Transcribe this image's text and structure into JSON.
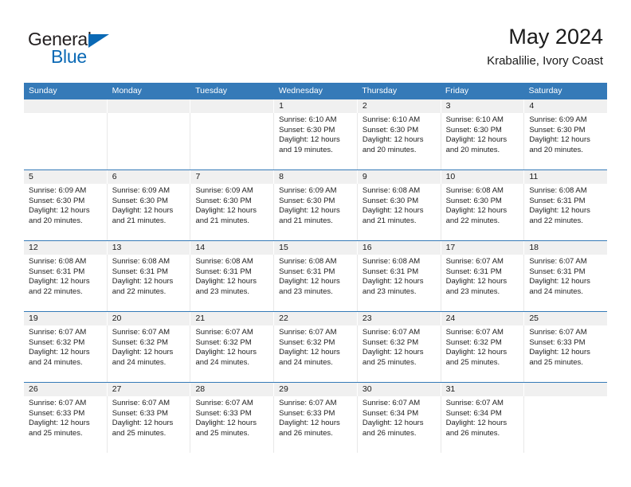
{
  "brand": {
    "name_part1": "General",
    "name_part2": "Blue",
    "logo_icon": "triangle-icon"
  },
  "header": {
    "title": "May 2024",
    "subtitle": "Krabalilie, Ivory Coast"
  },
  "colors": {
    "header_blue": "#357ab8",
    "brand_blue": "#0a69b5",
    "date_band": "#f0f0f0",
    "text": "#1a1a1a"
  },
  "weekdays": [
    "Sunday",
    "Monday",
    "Tuesday",
    "Wednesday",
    "Thursday",
    "Friday",
    "Saturday"
  ],
  "weeks": [
    {
      "days": [
        {
          "num": "",
          "lines": []
        },
        {
          "num": "",
          "lines": []
        },
        {
          "num": "",
          "lines": []
        },
        {
          "num": "1",
          "lines": [
            "Sunrise: 6:10 AM",
            "Sunset: 6:30 PM",
            "Daylight: 12 hours",
            "and 19 minutes."
          ]
        },
        {
          "num": "2",
          "lines": [
            "Sunrise: 6:10 AM",
            "Sunset: 6:30 PM",
            "Daylight: 12 hours",
            "and 20 minutes."
          ]
        },
        {
          "num": "3",
          "lines": [
            "Sunrise: 6:10 AM",
            "Sunset: 6:30 PM",
            "Daylight: 12 hours",
            "and 20 minutes."
          ]
        },
        {
          "num": "4",
          "lines": [
            "Sunrise: 6:09 AM",
            "Sunset: 6:30 PM",
            "Daylight: 12 hours",
            "and 20 minutes."
          ]
        }
      ]
    },
    {
      "days": [
        {
          "num": "5",
          "lines": [
            "Sunrise: 6:09 AM",
            "Sunset: 6:30 PM",
            "Daylight: 12 hours",
            "and 20 minutes."
          ]
        },
        {
          "num": "6",
          "lines": [
            "Sunrise: 6:09 AM",
            "Sunset: 6:30 PM",
            "Daylight: 12 hours",
            "and 21 minutes."
          ]
        },
        {
          "num": "7",
          "lines": [
            "Sunrise: 6:09 AM",
            "Sunset: 6:30 PM",
            "Daylight: 12 hours",
            "and 21 minutes."
          ]
        },
        {
          "num": "8",
          "lines": [
            "Sunrise: 6:09 AM",
            "Sunset: 6:30 PM",
            "Daylight: 12 hours",
            "and 21 minutes."
          ]
        },
        {
          "num": "9",
          "lines": [
            "Sunrise: 6:08 AM",
            "Sunset: 6:30 PM",
            "Daylight: 12 hours",
            "and 21 minutes."
          ]
        },
        {
          "num": "10",
          "lines": [
            "Sunrise: 6:08 AM",
            "Sunset: 6:30 PM",
            "Daylight: 12 hours",
            "and 22 minutes."
          ]
        },
        {
          "num": "11",
          "lines": [
            "Sunrise: 6:08 AM",
            "Sunset: 6:31 PM",
            "Daylight: 12 hours",
            "and 22 minutes."
          ]
        }
      ]
    },
    {
      "days": [
        {
          "num": "12",
          "lines": [
            "Sunrise: 6:08 AM",
            "Sunset: 6:31 PM",
            "Daylight: 12 hours",
            "and 22 minutes."
          ]
        },
        {
          "num": "13",
          "lines": [
            "Sunrise: 6:08 AM",
            "Sunset: 6:31 PM",
            "Daylight: 12 hours",
            "and 22 minutes."
          ]
        },
        {
          "num": "14",
          "lines": [
            "Sunrise: 6:08 AM",
            "Sunset: 6:31 PM",
            "Daylight: 12 hours",
            "and 23 minutes."
          ]
        },
        {
          "num": "15",
          "lines": [
            "Sunrise: 6:08 AM",
            "Sunset: 6:31 PM",
            "Daylight: 12 hours",
            "and 23 minutes."
          ]
        },
        {
          "num": "16",
          "lines": [
            "Sunrise: 6:08 AM",
            "Sunset: 6:31 PM",
            "Daylight: 12 hours",
            "and 23 minutes."
          ]
        },
        {
          "num": "17",
          "lines": [
            "Sunrise: 6:07 AM",
            "Sunset: 6:31 PM",
            "Daylight: 12 hours",
            "and 23 minutes."
          ]
        },
        {
          "num": "18",
          "lines": [
            "Sunrise: 6:07 AM",
            "Sunset: 6:31 PM",
            "Daylight: 12 hours",
            "and 24 minutes."
          ]
        }
      ]
    },
    {
      "days": [
        {
          "num": "19",
          "lines": [
            "Sunrise: 6:07 AM",
            "Sunset: 6:32 PM",
            "Daylight: 12 hours",
            "and 24 minutes."
          ]
        },
        {
          "num": "20",
          "lines": [
            "Sunrise: 6:07 AM",
            "Sunset: 6:32 PM",
            "Daylight: 12 hours",
            "and 24 minutes."
          ]
        },
        {
          "num": "21",
          "lines": [
            "Sunrise: 6:07 AM",
            "Sunset: 6:32 PM",
            "Daylight: 12 hours",
            "and 24 minutes."
          ]
        },
        {
          "num": "22",
          "lines": [
            "Sunrise: 6:07 AM",
            "Sunset: 6:32 PM",
            "Daylight: 12 hours",
            "and 24 minutes."
          ]
        },
        {
          "num": "23",
          "lines": [
            "Sunrise: 6:07 AM",
            "Sunset: 6:32 PM",
            "Daylight: 12 hours",
            "and 25 minutes."
          ]
        },
        {
          "num": "24",
          "lines": [
            "Sunrise: 6:07 AM",
            "Sunset: 6:32 PM",
            "Daylight: 12 hours",
            "and 25 minutes."
          ]
        },
        {
          "num": "25",
          "lines": [
            "Sunrise: 6:07 AM",
            "Sunset: 6:33 PM",
            "Daylight: 12 hours",
            "and 25 minutes."
          ]
        }
      ]
    },
    {
      "days": [
        {
          "num": "26",
          "lines": [
            "Sunrise: 6:07 AM",
            "Sunset: 6:33 PM",
            "Daylight: 12 hours",
            "and 25 minutes."
          ]
        },
        {
          "num": "27",
          "lines": [
            "Sunrise: 6:07 AM",
            "Sunset: 6:33 PM",
            "Daylight: 12 hours",
            "and 25 minutes."
          ]
        },
        {
          "num": "28",
          "lines": [
            "Sunrise: 6:07 AM",
            "Sunset: 6:33 PM",
            "Daylight: 12 hours",
            "and 25 minutes."
          ]
        },
        {
          "num": "29",
          "lines": [
            "Sunrise: 6:07 AM",
            "Sunset: 6:33 PM",
            "Daylight: 12 hours",
            "and 26 minutes."
          ]
        },
        {
          "num": "30",
          "lines": [
            "Sunrise: 6:07 AM",
            "Sunset: 6:34 PM",
            "Daylight: 12 hours",
            "and 26 minutes."
          ]
        },
        {
          "num": "31",
          "lines": [
            "Sunrise: 6:07 AM",
            "Sunset: 6:34 PM",
            "Daylight: 12 hours",
            "and 26 minutes."
          ]
        },
        {
          "num": "",
          "lines": []
        }
      ]
    }
  ]
}
